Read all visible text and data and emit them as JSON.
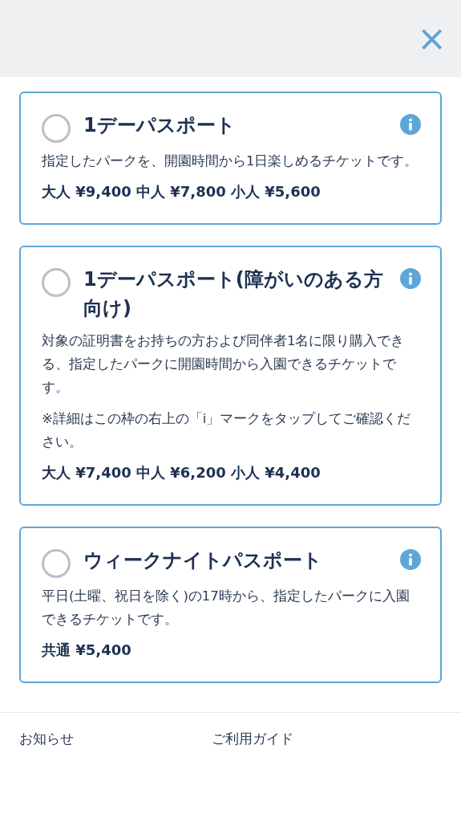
{
  "header": {
    "close": "×"
  },
  "tickets": [
    {
      "title": "1デーパスポート",
      "selected": false,
      "descriptions": [
        "指定したパークを、開園時間から1日楽しめるチケットです。"
      ],
      "prices": "大人 ¥9,400 中人 ¥7,800 小人 ¥5,600"
    },
    {
      "title": "1デーパスポート(障がいのある方向け)",
      "selected": false,
      "descriptions": [
        "対象の証明書をお持ちの方および同伴者1名に限り購入できる、指定したパークに開園時間から入園できるチケットです。",
        "※詳細はこの枠の右上の「i」マークをタップしてご確認ください。"
      ],
      "prices": "大人 ¥7,400 中人 ¥6,200 小人 ¥4,400"
    },
    {
      "title": "ウィークナイトパスポート",
      "selected": false,
      "descriptions": [
        "平日(土曜、祝日を除く)の17時から、指定したパークに入園できるチケットです。"
      ],
      "prices": "共通 ¥5,400"
    }
  ],
  "footer_links": [
    "お知らせ",
    "ご利用ガイド"
  ]
}
